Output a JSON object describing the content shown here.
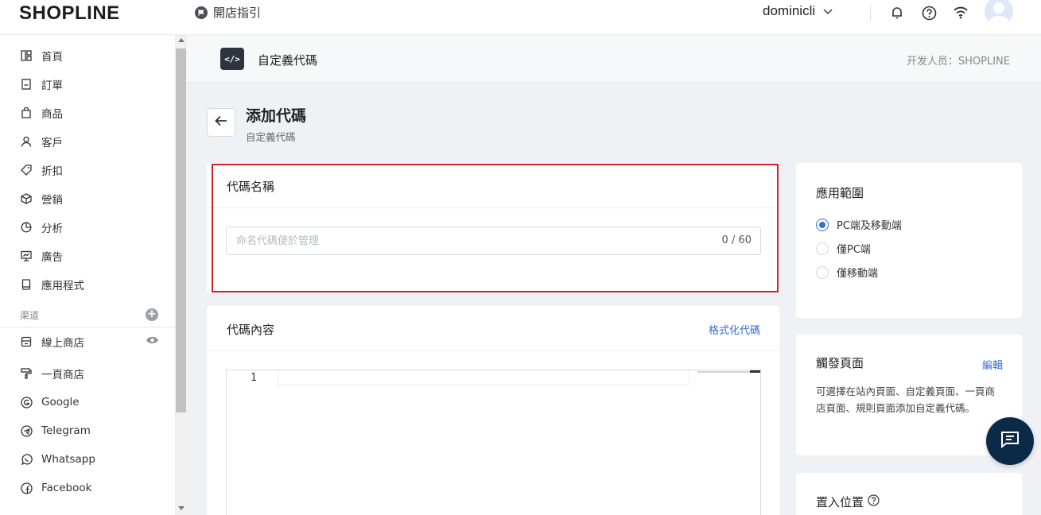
{
  "header": {
    "logo": "SHOPLINE",
    "guide_label": "開店指引",
    "username": "dominicli"
  },
  "sidebar": {
    "items": [
      {
        "label": "首頁",
        "icon": "home-icon"
      },
      {
        "label": "訂單",
        "icon": "orders-icon"
      },
      {
        "label": "商品",
        "icon": "bag-icon"
      },
      {
        "label": "客戶",
        "icon": "person-icon"
      },
      {
        "label": "折扣",
        "icon": "tag-icon"
      },
      {
        "label": "營銷",
        "icon": "box-icon"
      },
      {
        "label": "分析",
        "icon": "pie-icon"
      },
      {
        "label": "廣告",
        "icon": "monitor-icon"
      },
      {
        "label": "應用程式",
        "icon": "app-icon"
      }
    ],
    "channels_label": "渠道",
    "channels": [
      {
        "label": "線上商店",
        "icon": "store-icon"
      },
      {
        "label": "一頁商店",
        "icon": "paint-roller-icon"
      },
      {
        "label": "Google",
        "icon": "google-icon"
      },
      {
        "label": "Telegram",
        "icon": "telegram-icon"
      },
      {
        "label": "Whatsapp",
        "icon": "whatsapp-icon"
      },
      {
        "label": "Facebook",
        "icon": "facebook-icon"
      }
    ]
  },
  "subheader": {
    "icon_text": "</>",
    "title": "自定義代碼",
    "developer": "开发人员：SHOPLINE"
  },
  "page": {
    "title": "添加代碼",
    "subtitle": "自定義代碼"
  },
  "name_card": {
    "title": "代碼名稱",
    "placeholder": "命名代碼便於管理",
    "value": "",
    "counter": "0 / 60"
  },
  "code_card": {
    "title": "代碼內容",
    "format_link": "格式化代碼",
    "line_number": "1"
  },
  "scope_card": {
    "title": "應用範圍",
    "options": [
      {
        "label": "PC端及移動端",
        "selected": true
      },
      {
        "label": "僅PC端",
        "selected": false
      },
      {
        "label": "僅移動端",
        "selected": false
      }
    ]
  },
  "trigger_card": {
    "title": "觸發頁面",
    "edit_link": "編輯",
    "description": "可選擇在站內頁面、自定義頁面、一頁商店頁面、規則頁面添加自定義代碼。"
  },
  "place_card": {
    "title": "置入位置"
  },
  "colors": {
    "accent": "#3a6dd8",
    "highlight_border": "#d32029",
    "chat_button": "#0b2a48"
  }
}
